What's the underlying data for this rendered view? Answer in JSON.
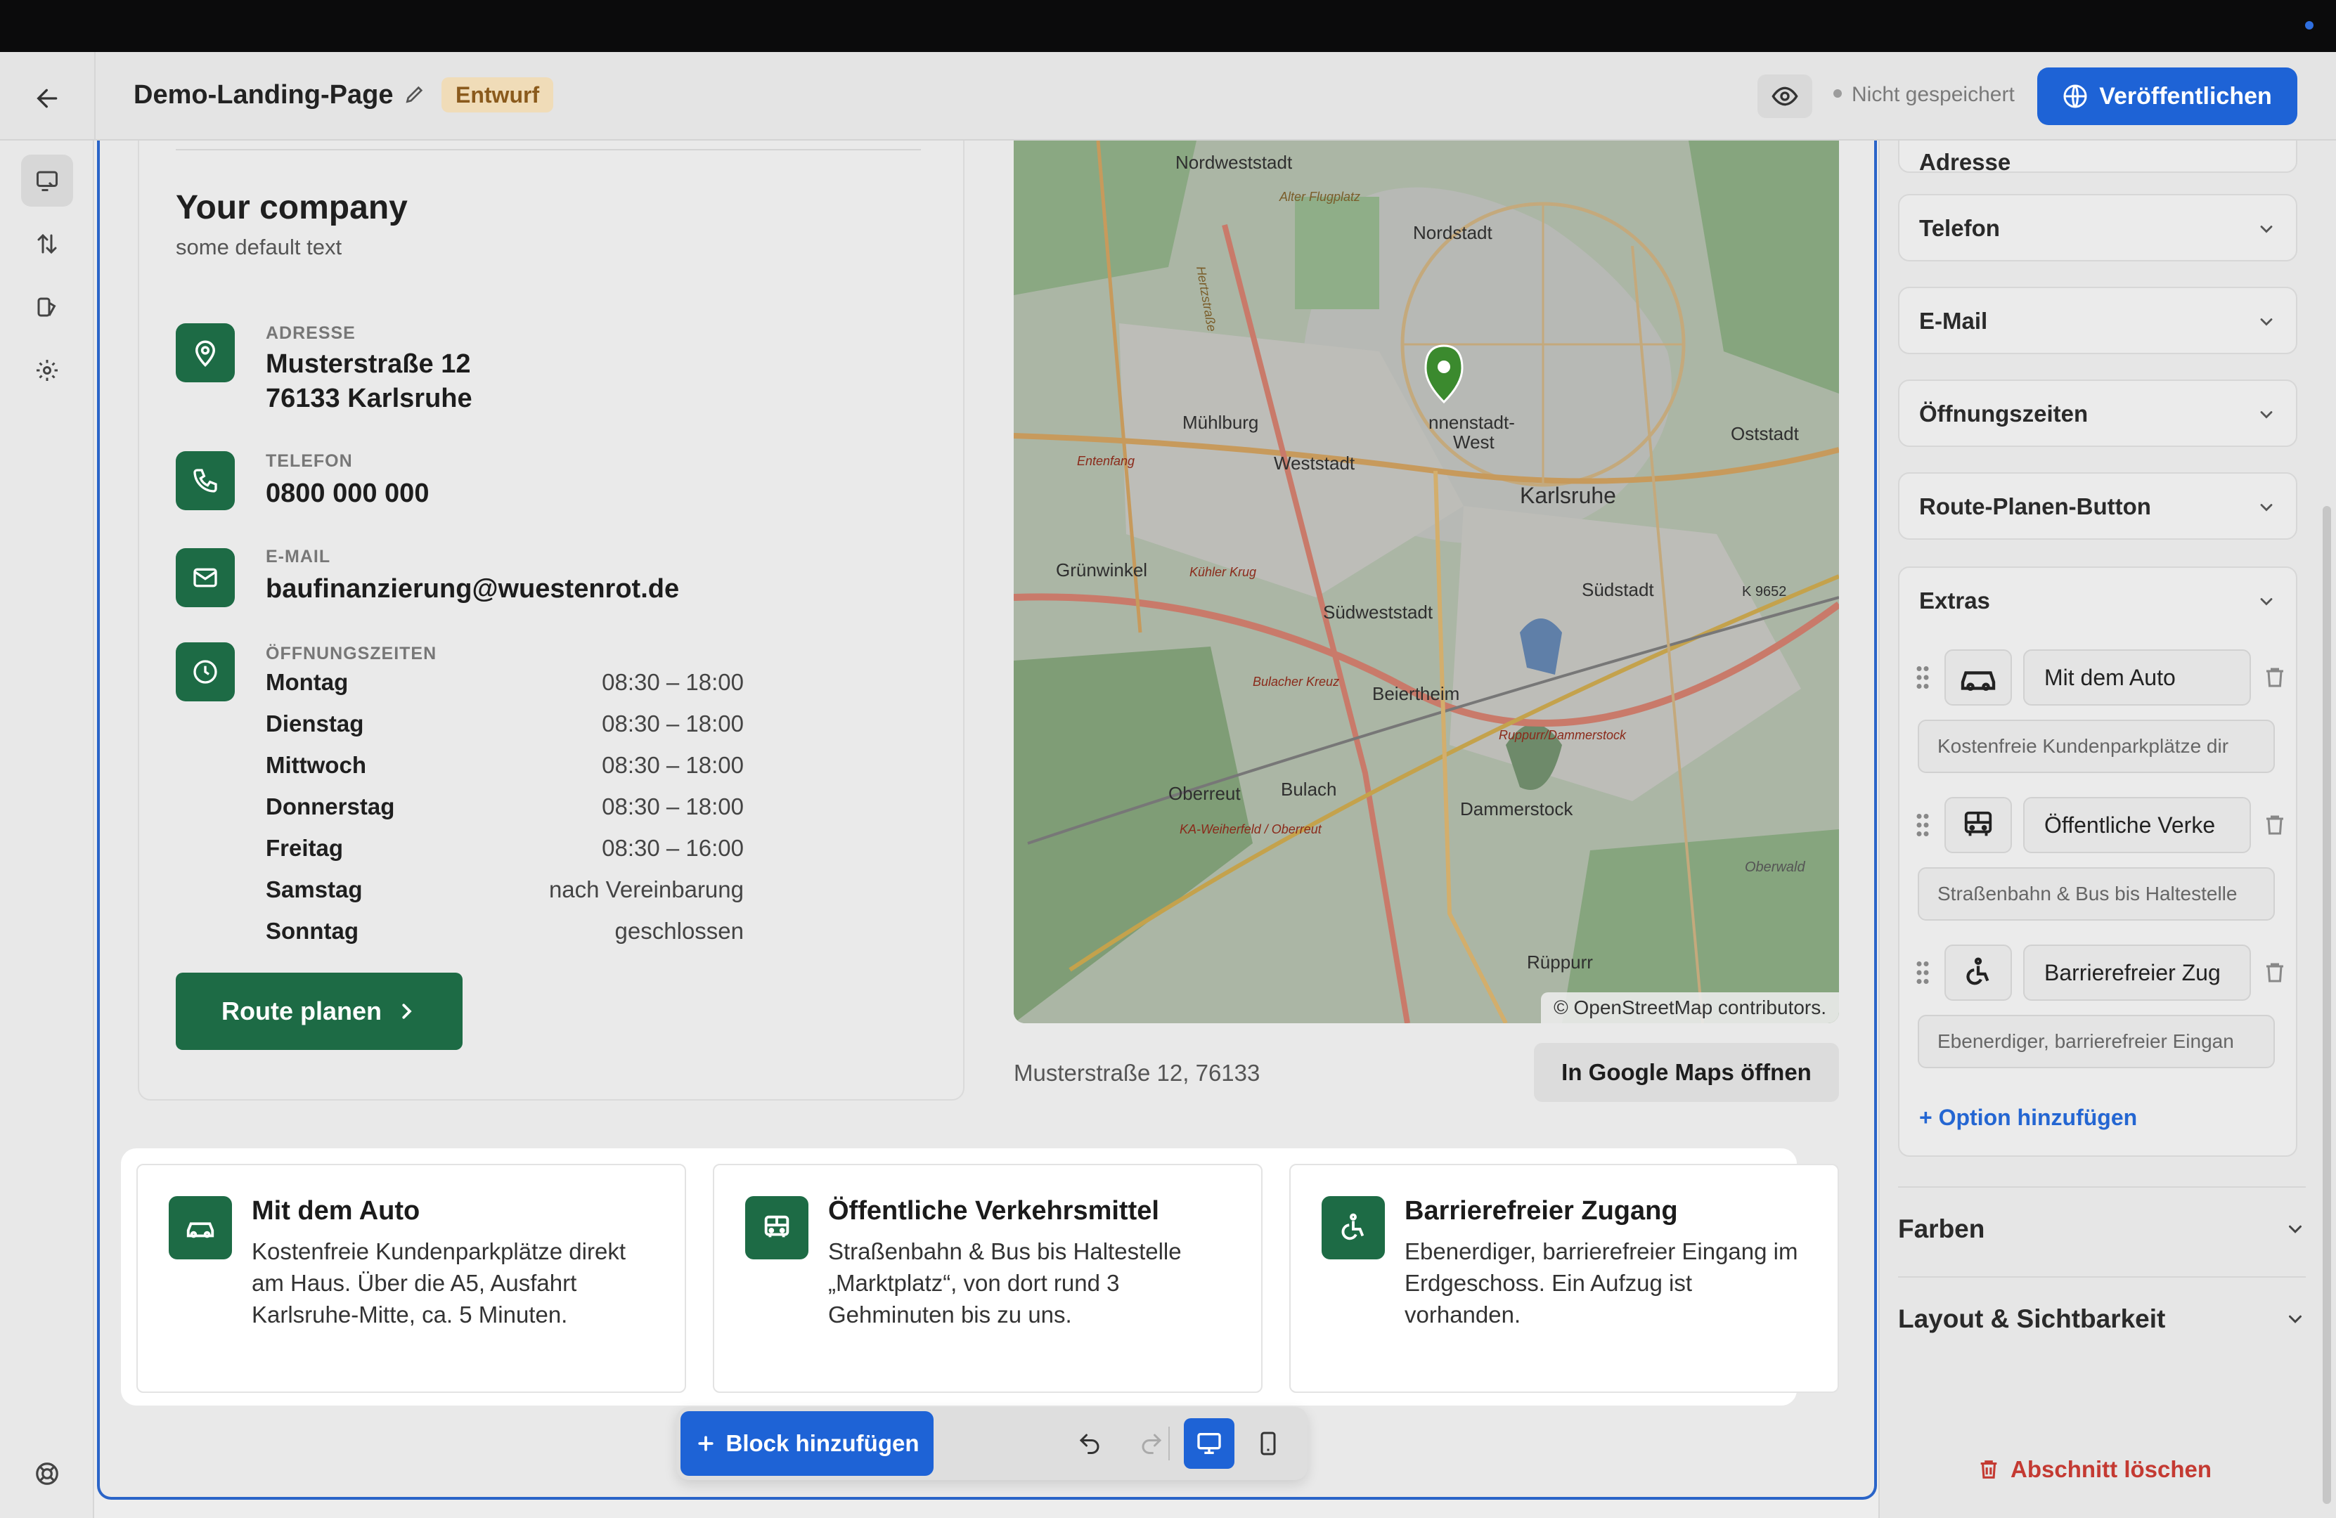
{
  "header": {
    "page_title": "Demo-Landing-Page",
    "status_badge": "Entwurf",
    "save_status": "Nicht gespeichert",
    "publish_label": "Veröffentlichen"
  },
  "contact": {
    "company_name": "Your company",
    "company_sub": "some default text",
    "address_label": "ADRESSE",
    "address_line1": "Musterstraße 12",
    "address_line2": "76133 Karlsruhe",
    "phone_label": "TELEFON",
    "phone_value": "0800 000 000",
    "email_label": "E-MAIL",
    "email_value": "baufinanzierung@wuestenrot.de",
    "hours_label": "ÖFFNUNGSZEITEN",
    "hours": [
      {
        "day": "Montag",
        "time": "08:30 – 18:00"
      },
      {
        "day": "Dienstag",
        "time": "08:30 – 18:00"
      },
      {
        "day": "Mittwoch",
        "time": "08:30 – 18:00"
      },
      {
        "day": "Donnerstag",
        "time": "08:30 – 18:00"
      },
      {
        "day": "Freitag",
        "time": "08:30 – 16:00"
      },
      {
        "day": "Samstag",
        "time": "nach Vereinbarung"
      },
      {
        "day": "Sonntag",
        "time": "geschlossen"
      }
    ],
    "route_button": "Route planen"
  },
  "map": {
    "attribution": "© OpenStreetMap contributors.",
    "address": "Musterstraße 12, 76133",
    "gmaps_button": "In Google Maps öffnen",
    "labels": {
      "nordweststadt": "Nordweststadt",
      "flugplatz": "Alter Flugplatz",
      "nordstadt": "Nordstadt",
      "muehlburg": "Mühlburg",
      "innenstadt": "nnenstadt-",
      "west": "West",
      "oststadt": "Oststadt",
      "weststadt": "Weststadt",
      "karlsruhe": "Karlsruhe",
      "gruenwinkel": "Grünwinkel",
      "suedweststadt": "Südweststadt",
      "suedstadt": "Südstadt",
      "k9652": "K 9652",
      "beiertheim": "Beiertheim",
      "bulach": "Bulach",
      "oberreut": "Oberreut",
      "dammerstock": "Dammerstock",
      "rueppurr": "Rüppurr",
      "entenfang": "Entenfang",
      "kuehler_krug": "Kühler Krug",
      "bulacher_kreuz": "Bulacher Kreuz",
      "ka_weiherfeld": "KA-Weiherfeld / Oberreut",
      "ruppurr_dammerstock": "Ruppurr/Dammerstock",
      "oberwald": "Oberwald",
      "hertzstrasse": "Hertzstraße"
    }
  },
  "extras_block": [
    {
      "title": "Mit dem Auto",
      "desc": "Kostenfreie Kundenparkplätze direkt am Haus. Über die A5, Ausfahrt Karlsruhe-Mitte, ca. 5 Minuten.",
      "icon": "car-icon"
    },
    {
      "title": "Öffentliche Verkehrsmittel",
      "desc": "Straßenbahn & Bus bis Haltestelle „Marktplatz“, von dort rund 3 Gehminuten bis zu uns.",
      "icon": "bus-icon"
    },
    {
      "title": "Barrierefreier Zugang",
      "desc": "Ebenerdiger, barrierefreier Eingang im Erdgeschoss. Ein Aufzug ist vorhanden.",
      "icon": "wheelchair-icon"
    }
  ],
  "toolbar": {
    "add_block": "Block hinzufügen"
  },
  "panel": {
    "partial_label": "Adresse",
    "accordions": [
      "Telefon",
      "E-Mail",
      "Öffnungszeiten",
      "Route-Planen-Button"
    ],
    "extras_label": "Extras",
    "options": [
      {
        "title": "Mit dem Auto",
        "desc": "Kostenfreie Kundenparkplätze dir",
        "icon": "car-icon"
      },
      {
        "title": "Öffentliche Verke",
        "desc": "Straßenbahn & Bus bis Haltestelle",
        "icon": "bus-icon"
      },
      {
        "title": "Barrierefreier Zug",
        "desc": "Ebenerdiger, barrierefreier Eingan",
        "icon": "wheelchair-icon"
      }
    ],
    "add_option": "Option hinzufügen",
    "sections": [
      "Farben",
      "Layout & Sichtbarkeit"
    ],
    "delete_section": "Abschnitt löschen"
  },
  "colors": {
    "accent_blue": "#1e63d6",
    "brand_green": "#1d6b45",
    "draft_badge": "#f0dcb8",
    "danger": "#c43a32"
  }
}
